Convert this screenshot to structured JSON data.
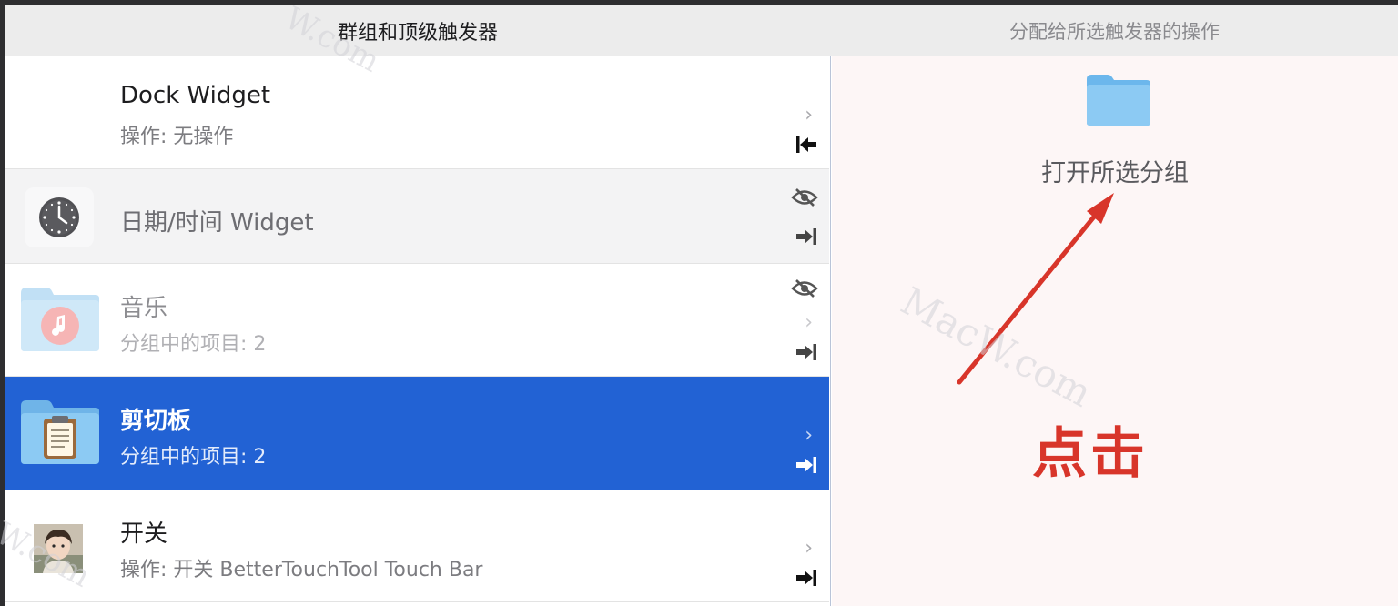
{
  "header": {
    "left_title": "群组和顶级触发器",
    "right_title": "分配给所选触发器的操作"
  },
  "rows": [
    {
      "title": "Dock Widget",
      "subtitle": "操作: 无操作",
      "chevron": "›",
      "icon": "none",
      "marker": "arrow-left-to-bar-icon",
      "hidden": false,
      "selected": false
    },
    {
      "title": "日期/时间 Widget",
      "subtitle": "",
      "icon": "clock-icon",
      "marker": "arrow-right-to-bar-icon",
      "hidden": true,
      "selected": false
    },
    {
      "title": "音乐",
      "subtitle": "分组中的项目: 2",
      "chevron": "›",
      "icon": "music-folder-icon",
      "marker": "arrow-right-to-bar-icon",
      "hidden": true,
      "selected": false
    },
    {
      "title": "剪切板",
      "subtitle": "分组中的项目: 2",
      "chevron": "›",
      "icon": "clipboard-folder-icon",
      "marker": "arrow-right-to-bar-icon",
      "hidden": false,
      "selected": true
    },
    {
      "title": "开关",
      "subtitle": "操作: 开关 BetterTouchTool Touch Bar",
      "chevron": "›",
      "icon": "avatar-photo",
      "marker": "arrow-right-to-bar-icon",
      "hidden": false,
      "selected": false
    }
  ],
  "detail": {
    "action_label": "打开所选分组",
    "icon": "folder-icon",
    "annotation": "点击",
    "annotation_color": "#d8352a"
  },
  "watermarks": [
    "MacW.com",
    "W.com",
    "W.com"
  ],
  "colors": {
    "selection": "#2262d4",
    "folder": "#7cc1f0",
    "arrow": "#d8352a"
  }
}
